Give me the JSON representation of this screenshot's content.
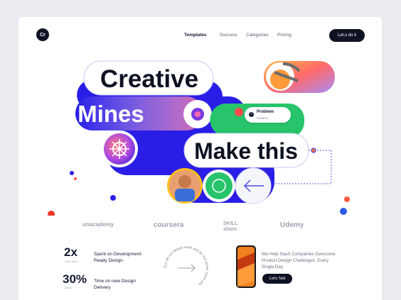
{
  "logo": "Cr",
  "nav": [
    "Templates",
    "Success",
    "Categories",
    "Pricing"
  ],
  "cta": "Let,s do it",
  "hero": {
    "line1": "Creative",
    "line2": "Mines",
    "line3": "Make this"
  },
  "problem_card": {
    "icon": "i",
    "title": "Problem",
    "subtitle": "Solution"
  },
  "brands": [
    "unacademy",
    "coursera",
    "SKILL share.",
    "Udemy"
  ],
  "stats": [
    {
      "num": "2x",
      "sub": "Lead Time",
      "desc": "Spent on Development- Ready Design"
    },
    {
      "num": "30%",
      "sub": "Cut by",
      "desc": "Time on new Design Delivery"
    }
  ],
  "circle_text": "Our ab out design work and be the power more info",
  "promo": {
    "text": "We Help SaaS Companies Overcome Product Design Challenges. Every Single Day.",
    "button": "Let's Talk"
  },
  "colors": {
    "blue": "#2a1ee6",
    "green": "#27c46b",
    "dark": "#0f1222",
    "accent_orange": "#ff7a45",
    "accent_pink": "#f24aa2"
  }
}
